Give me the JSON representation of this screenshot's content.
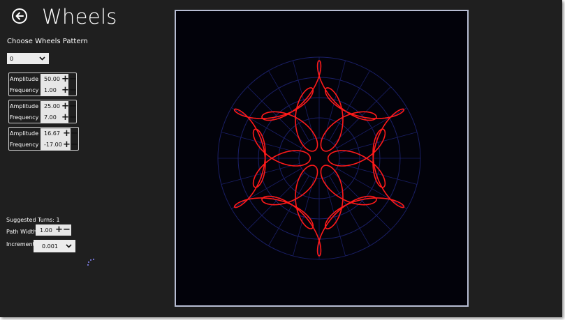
{
  "header": {
    "title": "Wheels",
    "back_icon": "back-arrow-icon"
  },
  "pattern": {
    "label": "Choose Wheels Pattern",
    "selected": "0"
  },
  "wheels": [
    {
      "amplitude_label": "Amplitude",
      "amplitude": "50.00",
      "frequency_label": "Frequency",
      "frequency": "1.00"
    },
    {
      "amplitude_label": "Amplitude",
      "amplitude": "25.00",
      "frequency_label": "Frequency",
      "frequency": "7.00"
    },
    {
      "amplitude_label": "Amplitude",
      "amplitude": "16.67",
      "frequency_label": "Frequency",
      "frequency": "-17.00"
    }
  ],
  "controls": {
    "plus": "+",
    "minus": "−",
    "suggested_turns": "Suggested Turns: 1",
    "path_width_label": "Path Width",
    "path_width": "1.00",
    "increment_label": "Increment",
    "increment": "0.001"
  },
  "colors": {
    "curve": "#ff1a1a",
    "grid": "#1a1f66",
    "canvas": "#02020a",
    "frame": "#b7bdd3"
  }
}
